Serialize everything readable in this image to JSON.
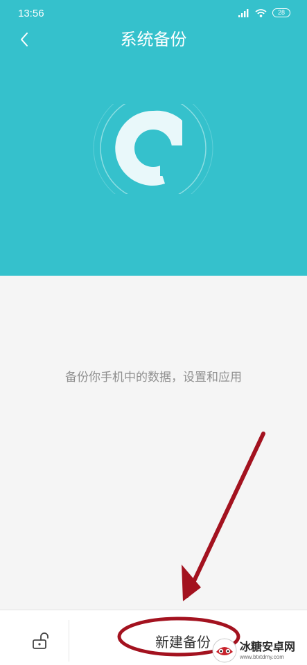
{
  "status_bar": {
    "time": "13:56",
    "battery": "28"
  },
  "header": {
    "title": "系统备份"
  },
  "main": {
    "description": "备份你手机中的数据，设置和应用"
  },
  "bottom_bar": {
    "new_backup_label": "新建备份"
  },
  "watermark": {
    "name": "冰糖安卓网",
    "url": "www.btxtdmy.com"
  },
  "colors": {
    "accent": "#35c1cc",
    "annotation": "#a3121f",
    "text_secondary": "#8f8f8f",
    "background": "#f5f5f5"
  }
}
